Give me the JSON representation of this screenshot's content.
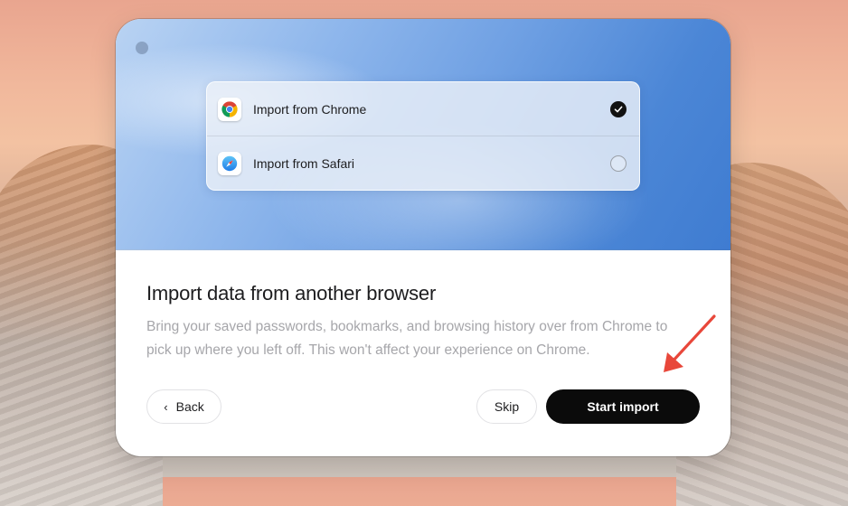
{
  "options": [
    {
      "label": "Import from Chrome",
      "icon": "chrome-icon",
      "selected": true
    },
    {
      "label": "Import from Safari",
      "icon": "safari-icon",
      "selected": false
    }
  ],
  "title": "Import data from another browser",
  "description": "Bring your saved passwords, bookmarks, and browsing history over from Chrome to pick up where you left off. This won't affect your experience on Chrome.",
  "buttons": {
    "back": "Back",
    "skip": "Skip",
    "start": "Start import"
  },
  "icons": {
    "back_chevron": "chevron-left-icon",
    "checked": "checkmark-icon",
    "annotation": "red-arrow-icon"
  },
  "colors": {
    "accent_dark": "#0b0b0b",
    "annotation_red": "#e8473a"
  }
}
